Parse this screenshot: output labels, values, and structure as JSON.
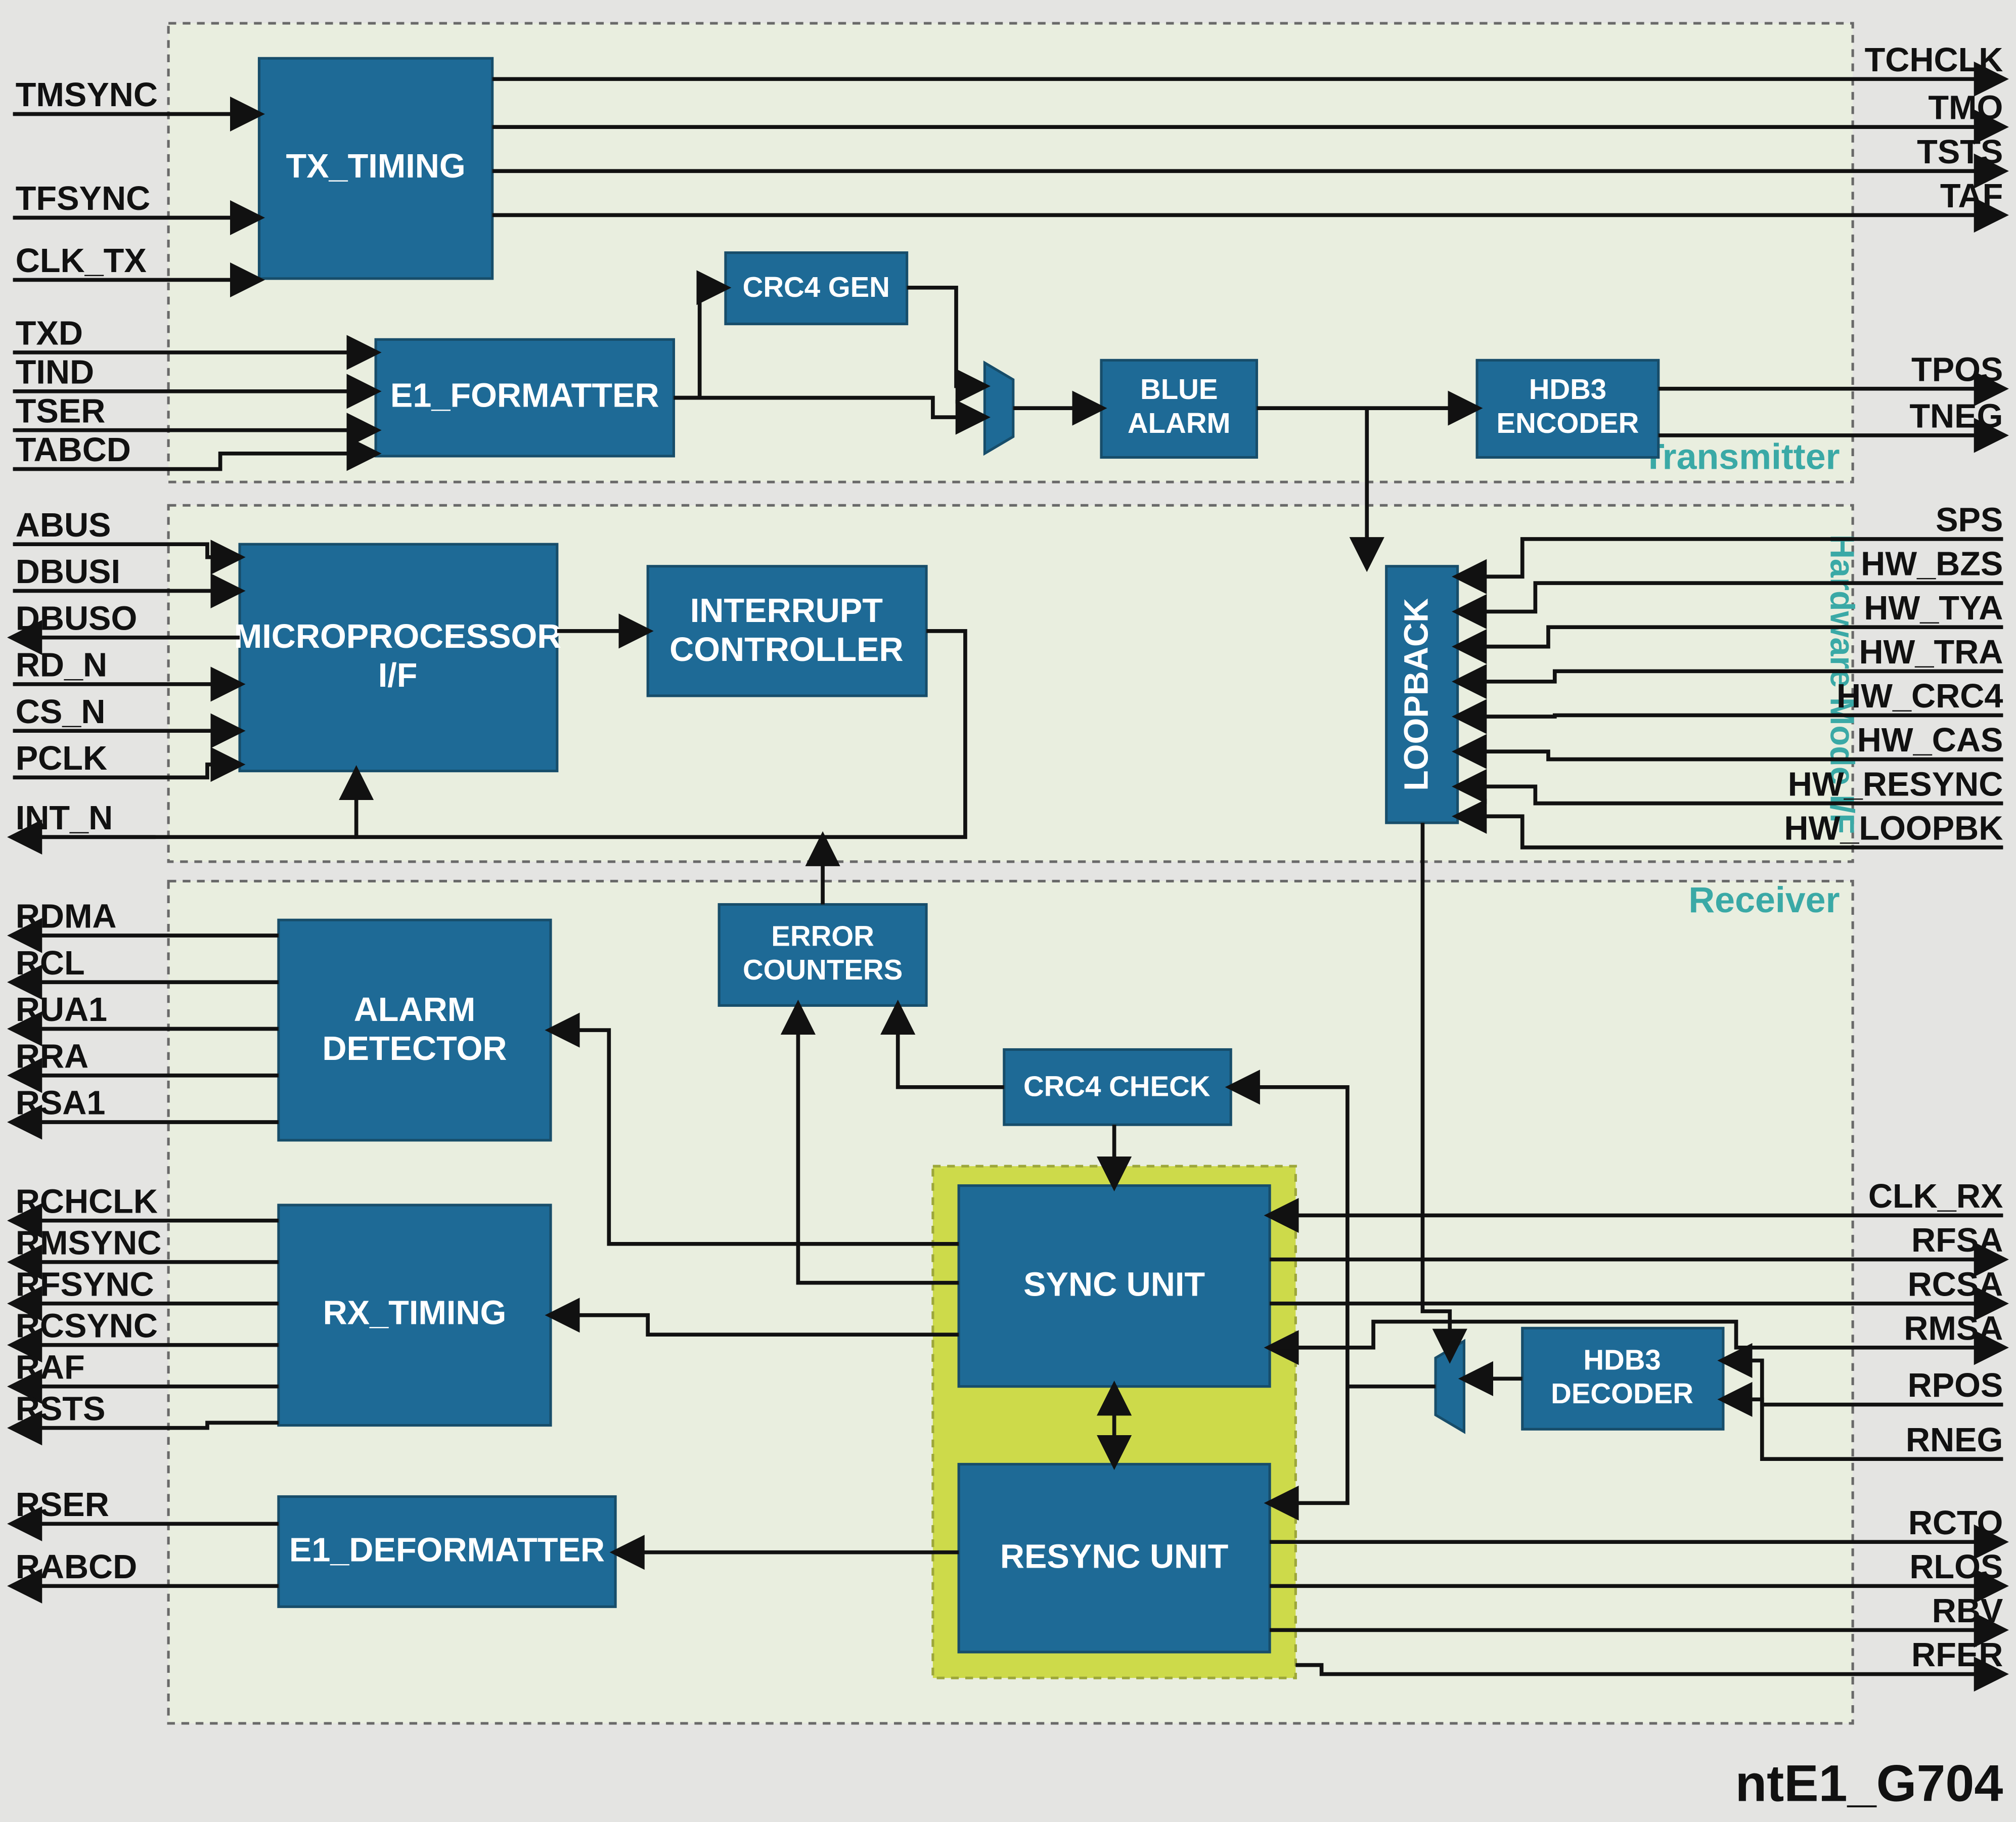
{
  "title": "ntE1_G704",
  "sections": {
    "transmitter": "Transmitter",
    "hwmode": "Hardware Mode I/F",
    "receiver": "Receiver"
  },
  "blocks": {
    "tx_timing": "TX_TIMING",
    "crc4_gen": "CRC4 GEN",
    "e1_formatter": "E1_FORMATTER",
    "blue_alarm_l1": "BLUE",
    "blue_alarm_l2": "ALARM",
    "hdb3_enc_l1": "HDB3",
    "hdb3_enc_l2": "ENCODER",
    "micro_l1": "MICROPROCESSOR",
    "micro_l2": "I/F",
    "intc_l1": "INTERRUPT",
    "intc_l2": "CONTROLLER",
    "loopback": "LOOPBACK",
    "alarm_det_l1": "ALARM",
    "alarm_det_l2": "DETECTOR",
    "error_cnt_l1": "ERROR",
    "error_cnt_l2": "COUNTERS",
    "crc4_check": "CRC4 CHECK",
    "rx_timing": "RX_TIMING",
    "e1_deformat": "E1_DEFORMATTER",
    "sync_unit": "SYNC UNIT",
    "resync_unit": "RESYNC UNIT",
    "hdb3_dec_l1": "HDB3",
    "hdb3_dec_l2": "DECODER"
  },
  "pins_left": {
    "tmsync": "TMSYNC",
    "tfsync": "TFSYNC",
    "clk_tx": "CLK_TX",
    "txd": "TXD",
    "tind": "TIND",
    "tser": "TSER",
    "tabcd": "TABCD",
    "abus": "ABUS",
    "dbusi": "DBUSI",
    "dbuso": "DBUSO",
    "rd_n": "RD_N",
    "cs_n": "CS_N",
    "pclk": "PCLK",
    "int_n": "INT_N",
    "rdma": "RDMA",
    "rcl": "RCL",
    "rua1": "RUA1",
    "rra": "RRA",
    "rsa1": "RSA1",
    "rchclk": "RCHCLK",
    "rmsync": "RMSYNC",
    "rfsync": "RFSYNC",
    "rcsync": "RCSYNC",
    "raf": "RAF",
    "rsts": "RSTS",
    "rser": "RSER",
    "rabcd": "RABCD"
  },
  "pins_right": {
    "tchclk": "TCHCLK",
    "tmo": "TMO",
    "tsts": "TSTS",
    "taf": "TAF",
    "tpos": "TPOS",
    "tneg": "TNEG",
    "sps": "SPS",
    "hw_bzs": "HW_BZS",
    "hw_tya": "HW_TYA",
    "hw_tra": "HW_TRA",
    "hw_crc4": "HW_CRC4",
    "hw_cas": "HW_CAS",
    "hw_resync": "HW_RESYNC",
    "hw_loopbk": "HW_LOOPBK",
    "clk_rx": "CLK_RX",
    "rfsa": "RFSA",
    "rcsa": "RCSA",
    "rmsa": "RMSA",
    "rpos": "RPOS",
    "rneg": "RNEG",
    "rcto": "RCTO",
    "rlos": "RLOS",
    "rbv": "RBV",
    "rfer": "RFER"
  }
}
